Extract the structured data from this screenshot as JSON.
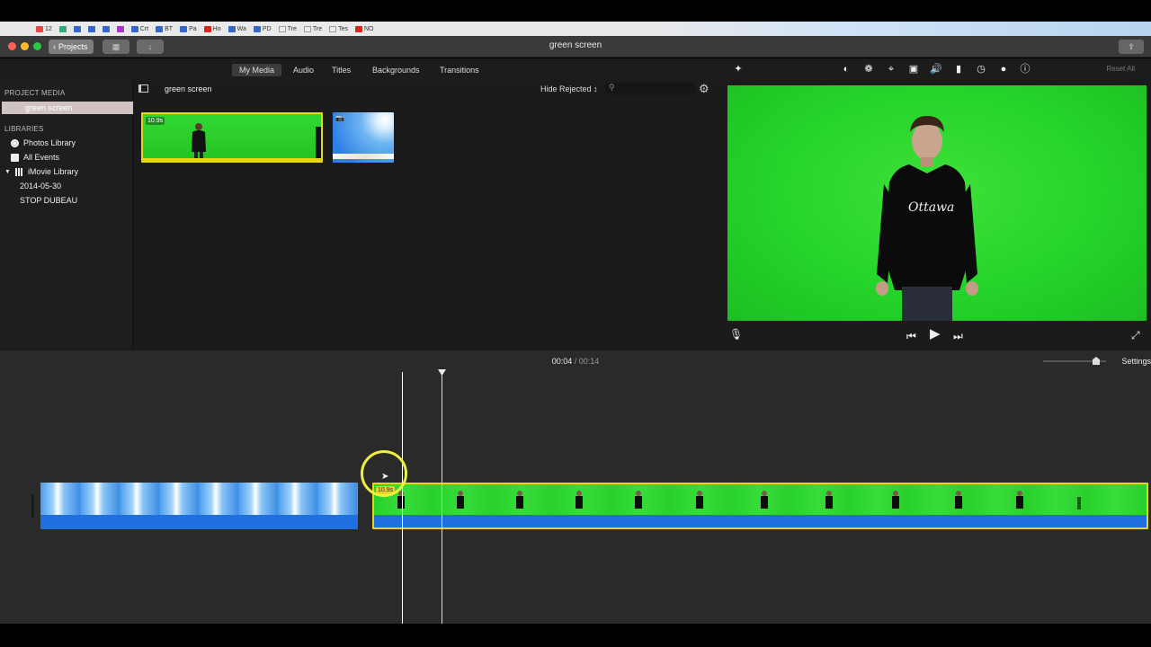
{
  "bookmarks": [
    "12",
    "Crt",
    "BT",
    "Pa",
    "Ho",
    "Wa",
    "PD",
    "Tre",
    "Tre",
    "Tes",
    "NO"
  ],
  "window": {
    "title": "green screen",
    "projects_label": "Projects"
  },
  "nav_tabs": [
    "My Media",
    "Audio",
    "Titles",
    "Backgrounds",
    "Transitions"
  ],
  "sidebar": {
    "project_media_heading": "PROJECT MEDIA",
    "project_item": "green screen",
    "libraries_heading": "LIBRARIES",
    "items": [
      "Photos Library",
      "All Events",
      "iMovie Library",
      "2014-05-30",
      "STOP DUBEAU"
    ]
  },
  "browser": {
    "title": "green screen",
    "filter": "Hide Rejected ↕",
    "clip_duration_badge": "10.9s"
  },
  "viewer": {
    "reset_all": "Reset All"
  },
  "timeline": {
    "current_time": "00:04",
    "separator": "/",
    "total_time": "00:14",
    "settings_label": "Settings",
    "clip_badge": "10.9s"
  },
  "colors": {
    "accent_green": "#25d42a",
    "sky_blue": "#2d7fe6",
    "clip_selection": "#e8d420",
    "highlight_ring": "#f0ef3c"
  }
}
